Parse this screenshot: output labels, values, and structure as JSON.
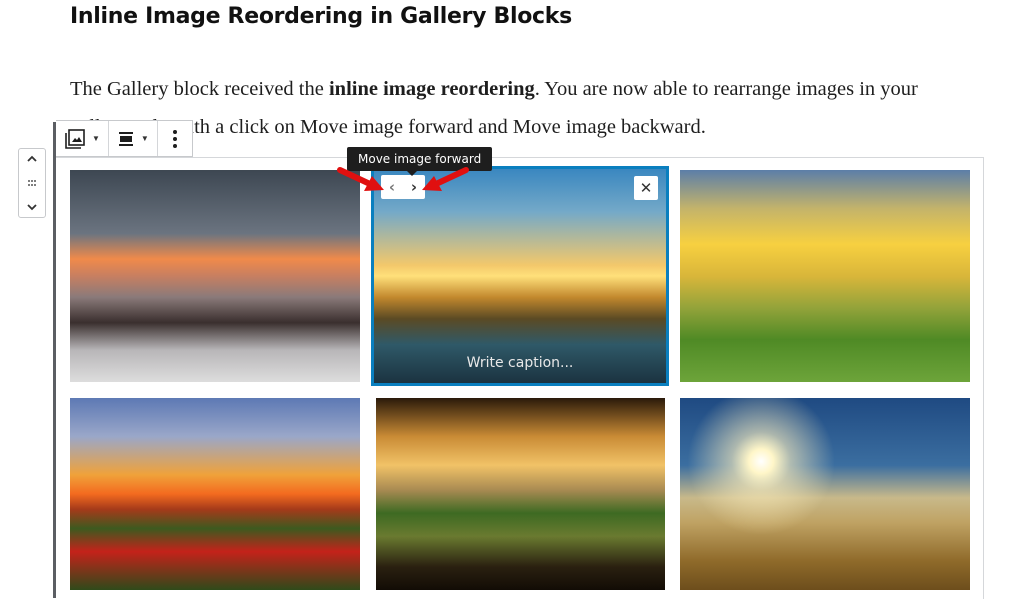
{
  "heading": "Inline Image Reordering in Gallery Blocks",
  "paragraph": {
    "before": "The Gallery block received the ",
    "bold": "inline image reordering",
    "after": ". You are now able to rearrange images in your gallery only with a click on Move image forward and Move image backward."
  },
  "toolbar": {
    "items": [
      {
        "icon": "gallery-icon",
        "has_dropdown": true
      },
      {
        "icon": "align-icon",
        "has_dropdown": true
      },
      {
        "icon": "more-options-icon",
        "has_dropdown": false
      }
    ]
  },
  "mover": {
    "up": "^",
    "drag": "⋮⋮",
    "down": "v"
  },
  "selected_image": {
    "tooltip": "Move image forward",
    "prev_label": "‹",
    "next_label": "›",
    "close_label": "✕",
    "caption_placeholder": "Write caption..."
  },
  "colors": {
    "selection": "#0a7fbf",
    "tooltip_bg": "#1e1e1e",
    "annotation_arrow": "#e01010"
  },
  "gallery": {
    "images": [
      {
        "subject": "snowy mountains at sunset with lake"
      },
      {
        "subject": "river at sunset with boats",
        "selected": true
      },
      {
        "subject": "green hills under golden sun"
      },
      {
        "subject": "poppy field at sunset with birds"
      },
      {
        "subject": "forest valley under trees at sunset"
      },
      {
        "subject": "sun rays over misty fields"
      }
    ]
  }
}
